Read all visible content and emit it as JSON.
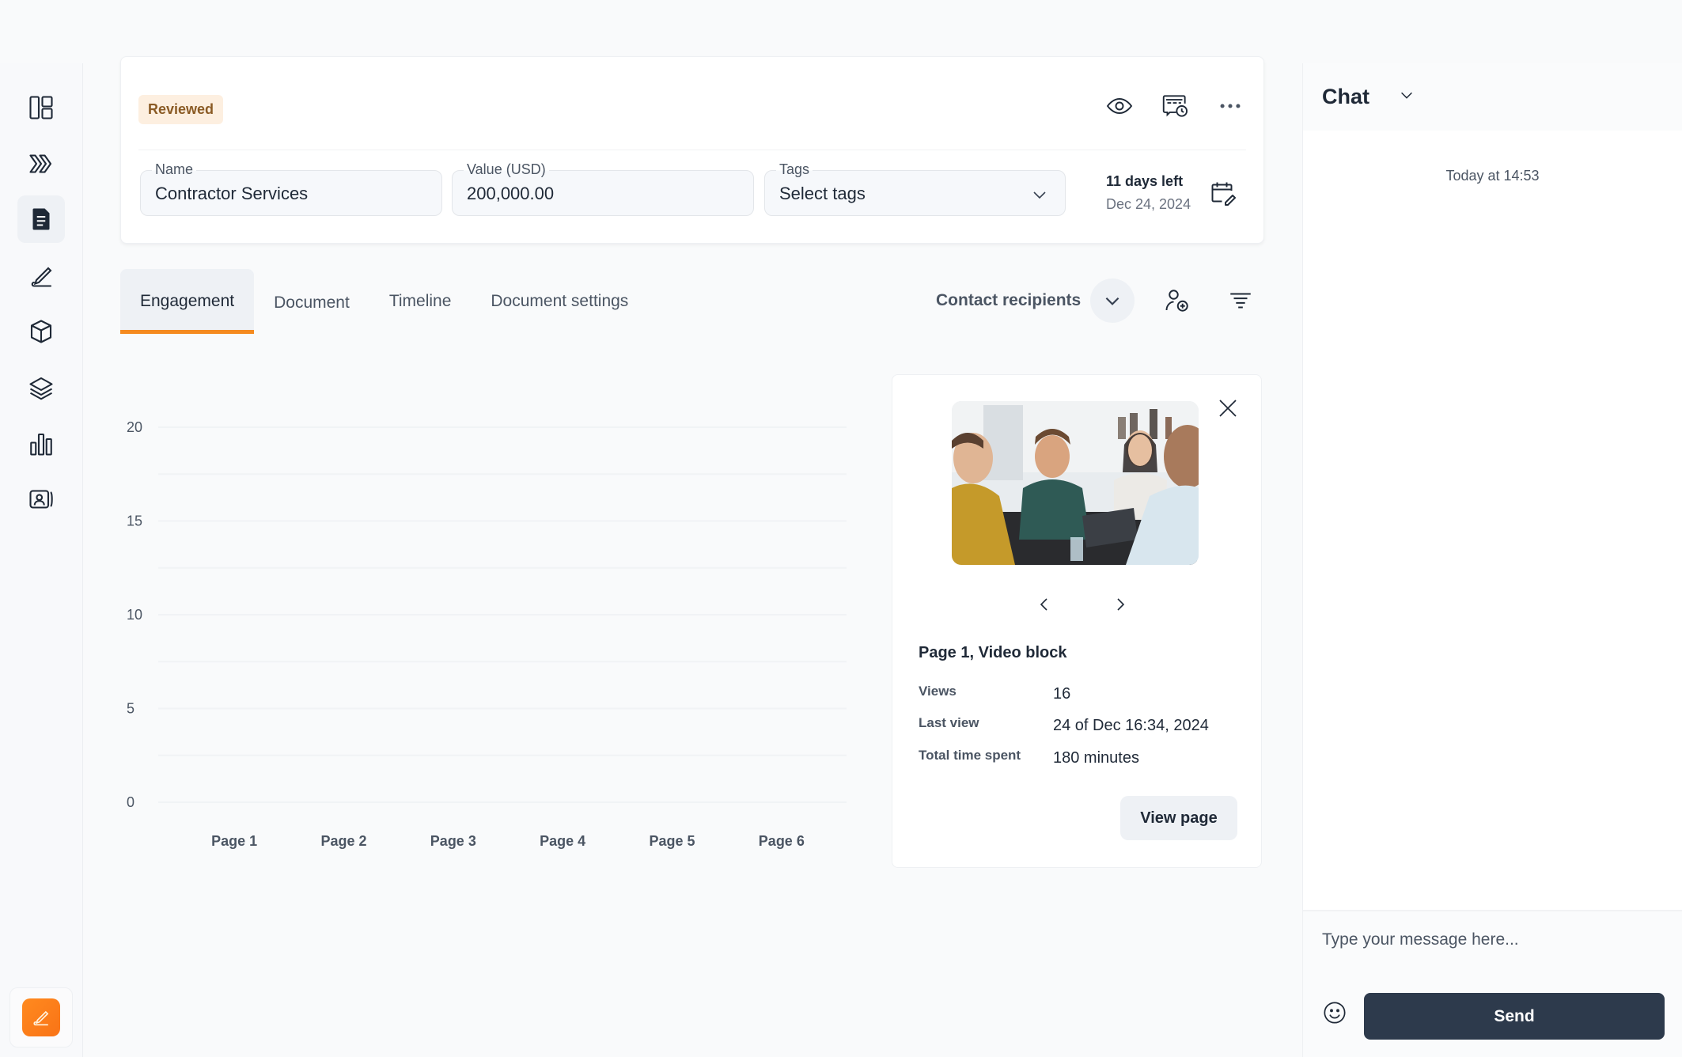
{
  "sidebar": {
    "items": [
      {
        "name": "dashboard",
        "icon": "layout-icon",
        "active": false
      },
      {
        "name": "pipeline",
        "icon": "chevrons-right-icon",
        "active": false
      },
      {
        "name": "documents",
        "icon": "document-icon",
        "active": true
      },
      {
        "name": "signatures",
        "icon": "signature-pen-icon",
        "active": false
      },
      {
        "name": "products",
        "icon": "cube-icon",
        "active": false
      },
      {
        "name": "templates",
        "icon": "layers-icon",
        "active": false
      },
      {
        "name": "analytics",
        "icon": "bar-chart-icon",
        "active": false
      },
      {
        "name": "contacts",
        "icon": "contact-card-icon",
        "active": false
      }
    ],
    "bottom_action": {
      "icon": "edit-pen-icon",
      "color": "#f97316"
    }
  },
  "header": {
    "status_badge": "Reviewed",
    "actions": [
      "eye-icon",
      "schedule-message-icon",
      "more-horizontal-icon"
    ],
    "fields": {
      "name": {
        "label": "Name",
        "value": "Contractor Services"
      },
      "value": {
        "label": "Value (USD)",
        "value": "200,000.00"
      },
      "tags": {
        "label": "Tags",
        "value": "Select tags"
      }
    },
    "deadline": {
      "days_left": "11 days left",
      "date": "Dec 24, 2024"
    }
  },
  "tabs": [
    {
      "label": "Engagement",
      "active": true
    },
    {
      "label": "Document",
      "active": false
    },
    {
      "label": "Timeline",
      "active": false
    },
    {
      "label": "Document settings",
      "active": false
    }
  ],
  "toolbar": {
    "contact_recipients": "Contact recipients"
  },
  "chart_data": {
    "type": "bar",
    "title": "",
    "xlabel": "",
    "ylabel": "",
    "categories": [
      "Page 1",
      "Page 2",
      "Page 3",
      "Page 4",
      "Page 5",
      "Page 6"
    ],
    "values": [
      null,
      null,
      null,
      null,
      null,
      null
    ],
    "ylim": [
      0,
      20
    ],
    "yticks": [
      0,
      5,
      10,
      15,
      20
    ],
    "grid": true,
    "legend": "none"
  },
  "detail": {
    "title": "Page 1, Video block",
    "stats": [
      {
        "label": "Views",
        "value": "16"
      },
      {
        "label": "Last view",
        "value": "24 of Dec 16:34, 2024"
      },
      {
        "label": "Total time spent",
        "value": "180 minutes"
      }
    ],
    "view_button": "View page"
  },
  "chat": {
    "title": "Chat",
    "timestamp": "Today at 14:53",
    "input_placeholder": "Type your message here...",
    "input_value": "",
    "send_label": "Send"
  },
  "colors": {
    "accent": "#f58a1f",
    "badge_bg": "#fdefe0",
    "badge_text": "#8a5a24",
    "send_bg": "#2d3a4c"
  }
}
